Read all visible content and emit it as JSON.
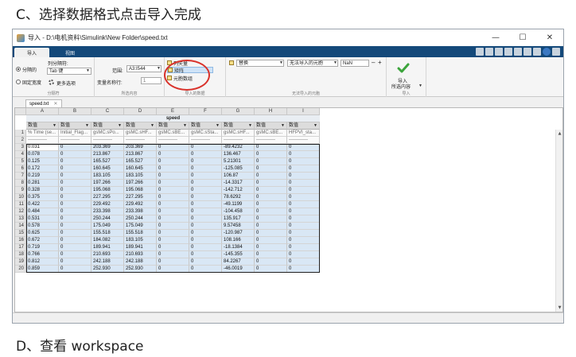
{
  "doc": {
    "heading_c": "C、选择数据格式点击导入完成",
    "heading_d": "D、查看 workspace"
  },
  "window": {
    "title": "导入 - D:\\电机资料\\Simulink\\New Folder\\speed.txt",
    "minimize": "—",
    "maximize": "☐",
    "close": "✕"
  },
  "ribbon_tabs": [
    "导入",
    "视图"
  ],
  "ribbon": {
    "delimited_label": "分隔的",
    "fixed_width_label": "固定宽度",
    "column_delim_label": "列分隔符:",
    "column_delim_value": "Tab 键",
    "more_options_label": "更多选项",
    "group_delimiters": "分隔符",
    "range_label": "范围:",
    "range_value": "A3:I544",
    "varnames_row_label": "变量名称行:",
    "varnames_row_value": "1",
    "group_selection": "所选内容",
    "output_types": [
      "列矢量",
      "矩阵",
      "元胞数组"
    ],
    "group_output_type": "导入的数据",
    "replace_label": "替换",
    "unimportable_label": "无法导入的元胞",
    "replace_with_value": "NaN",
    "group_unimportable": "无法导入的元胞",
    "import_button_line1": "导入",
    "import_button_line2": "所选内容",
    "group_import": "导入"
  },
  "doctab": {
    "name": "speed.txt",
    "close": "✕"
  },
  "sheet": {
    "columns": [
      "A",
      "B",
      "C",
      "D",
      "E",
      "F",
      "G",
      "H",
      "I"
    ],
    "variable_name": "speed",
    "type_label": "数值",
    "row_numbers": [
      "1",
      "2",
      "3",
      "4",
      "5",
      "6",
      "7",
      "8",
      "9",
      "10",
      "11",
      "12",
      "13",
      "14",
      "15",
      "16",
      "17",
      "18",
      "19",
      "20"
    ],
    "header_row": [
      "% Time (se...",
      "Initial_Flag...",
      "gsMC.sPo...",
      "gsMC.sHF...",
      "gsMC.sBE...",
      "gsMC.sSta...",
      "gsMC.sHF...",
      "gsMC.sBE...",
      "HFPVI_sta..."
    ],
    "dash_row": [
      "------------",
      "------------",
      "------------",
      "------------",
      "------------",
      "------------",
      "------------",
      "------------",
      "------------"
    ],
    "rows": [
      [
        "0.031",
        "0",
        "203.369",
        "203.369",
        "0",
        "0",
        "-89.4232",
        "0",
        "0"
      ],
      [
        "0.078",
        "0",
        "213.867",
        "213.867",
        "0",
        "0",
        "136.467",
        "0",
        "0"
      ],
      [
        "0.125",
        "0",
        "165.527",
        "165.527",
        "0",
        "0",
        "5.21301",
        "0",
        "0"
      ],
      [
        "0.172",
        "0",
        "160.645",
        "160.645",
        "0",
        "0",
        "-125.085",
        "0",
        "0"
      ],
      [
        "0.219",
        "0",
        "183.105",
        "183.105",
        "0",
        "0",
        "106.87",
        "0",
        "0"
      ],
      [
        "0.281",
        "0",
        "197.266",
        "197.266",
        "0",
        "0",
        "-14.3317",
        "0",
        "0"
      ],
      [
        "0.328",
        "0",
        "195.068",
        "195.068",
        "0",
        "0",
        "-142.712",
        "0",
        "0"
      ],
      [
        "0.375",
        "0",
        "227.295",
        "227.295",
        "0",
        "0",
        "78.6292",
        "0",
        "0"
      ],
      [
        "0.422",
        "0",
        "229.492",
        "229.492",
        "0",
        "0",
        "-49.1199",
        "0",
        "0"
      ],
      [
        "0.484",
        "0",
        "233.398",
        "233.398",
        "0",
        "0",
        "-104.458",
        "0",
        "0"
      ],
      [
        "0.531",
        "0",
        "250.244",
        "250.244",
        "0",
        "0",
        "135.917",
        "0",
        "0"
      ],
      [
        "0.578",
        "0",
        "175.049",
        "175.049",
        "0",
        "0",
        "9.57458",
        "0",
        "0"
      ],
      [
        "0.625",
        "0",
        "155.518",
        "155.518",
        "0",
        "0",
        "-120.987",
        "0",
        "0"
      ],
      [
        "0.672",
        "0",
        "184.082",
        "183.105",
        "0",
        "0",
        "108.166",
        "0",
        "0"
      ],
      [
        "0.719",
        "0",
        "189.941",
        "189.941",
        "0",
        "0",
        "-18.1384",
        "0",
        "0"
      ],
      [
        "0.766",
        "0",
        "210.693",
        "210.693",
        "0",
        "0",
        "-145.355",
        "0",
        "0"
      ],
      [
        "0.812",
        "0",
        "242.188",
        "242.188",
        "0",
        "0",
        "84.2267",
        "0",
        "0"
      ],
      [
        "0.859",
        "0",
        "252.930",
        "252.930",
        "0",
        "0",
        "-46.0019",
        "0",
        "0"
      ]
    ]
  }
}
